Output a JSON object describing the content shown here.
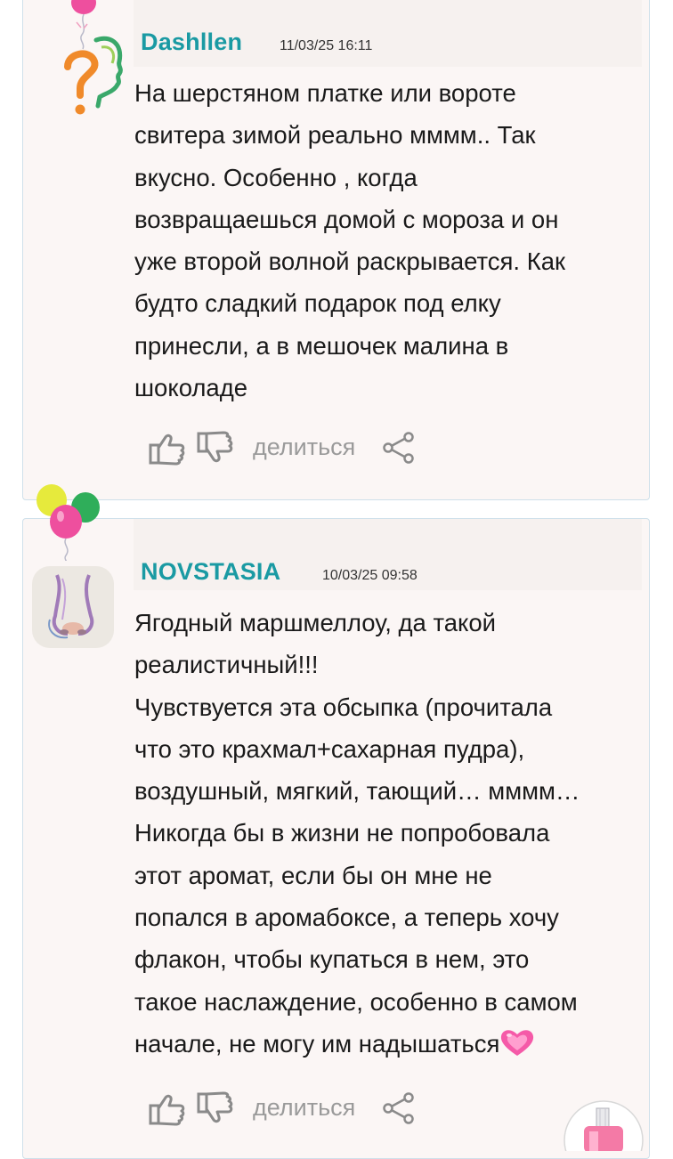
{
  "comments": [
    {
      "username": "Dashllen",
      "date": "11/03/25 16:11",
      "text": "На шерстяном платке или вороте\nсвитера зимой реально мммм.. Так\nвкусно. Особенно , когда\nвозвращаешься домой с мороза и он\nуже второй волной раскрывается. Как\nбудто сладкий подарок под елку\nпринесли, а в мешочек малина в\nшоколаде",
      "share_label": "делиться"
    },
    {
      "username": "NOVSTASIA",
      "date": "10/03/25 09:58",
      "text": "Ягодный маршмеллоу, да такой\nреалистичный!!!\nЧувствуется эта обсыпка (прочитала\nчто это крахмал+сахарная пудра),\nвоздушный, мягкий, тающий… мммм…\nНикогда бы в жизни не попробовала\nэтот аромат, если бы он мне не\nпопался в аромабоксе, а теперь хочу\nфлакон, чтобы купаться в нем, это\nтакое наслаждение, особенно в самом\nначале, не могу им надышаться",
      "share_label": "делиться"
    }
  ],
  "colors": {
    "username": "#1a9aa3",
    "card_bg": "#fbf6f5",
    "card_border": "#cfe0ea",
    "icon_gray": "#8a8a8a"
  },
  "icons": {
    "like": "thumbs-up-icon",
    "dislike": "thumbs-down-icon",
    "share": "share-icon",
    "heart": "growing-heart-emoji"
  }
}
